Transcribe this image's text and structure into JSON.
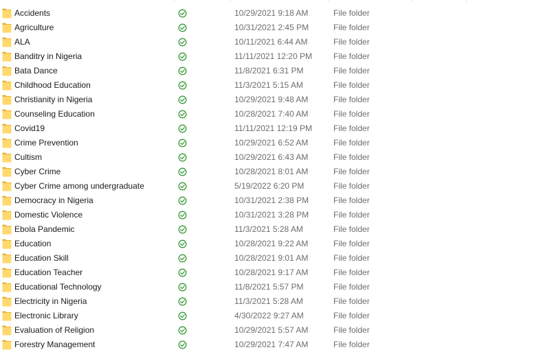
{
  "colors": {
    "folder_fill": "#FFD86E",
    "folder_edge": "#E8B43A",
    "sync_ok": "#3A9A3A",
    "name_text": "#1a1a1a",
    "meta_text": "#6d6d6d"
  },
  "icons": {
    "folder": "folder-icon",
    "status": "sync-available-icon"
  },
  "files": [
    {
      "name": "Accidents",
      "modified": "10/29/2021 9:18 AM",
      "type": "File folder"
    },
    {
      "name": "Agriculture",
      "modified": "10/31/2021 2:45 PM",
      "type": "File folder"
    },
    {
      "name": "ALA",
      "modified": "10/11/2021 6:44 AM",
      "type": "File folder"
    },
    {
      "name": "Banditry in Nigeria",
      "modified": "11/11/2021 12:20 PM",
      "type": "File folder"
    },
    {
      "name": "Bata Dance",
      "modified": "11/8/2021 6:31 PM",
      "type": "File folder"
    },
    {
      "name": "Childhood Education",
      "modified": "11/3/2021 5:15 AM",
      "type": "File folder"
    },
    {
      "name": "Christianity in Nigeria",
      "modified": "10/29/2021 9:48 AM",
      "type": "File folder"
    },
    {
      "name": "Counseling Education",
      "modified": "10/28/2021 7:40 AM",
      "type": "File folder"
    },
    {
      "name": "Covid19",
      "modified": "11/11/2021 12:19 PM",
      "type": "File folder"
    },
    {
      "name": "Crime Prevention",
      "modified": "10/29/2021 6:52 AM",
      "type": "File folder"
    },
    {
      "name": "Cultism",
      "modified": "10/29/2021 6:43 AM",
      "type": "File folder"
    },
    {
      "name": "Cyber Crime",
      "modified": "10/28/2021 8:01 AM",
      "type": "File folder"
    },
    {
      "name": "Cyber Crime among undergraduate",
      "modified": "5/19/2022 6:20 PM",
      "type": "File folder"
    },
    {
      "name": "Democracy in Nigeria",
      "modified": "10/31/2021 2:38 PM",
      "type": "File folder"
    },
    {
      "name": "Domestic Violence",
      "modified": "10/31/2021 3:28 PM",
      "type": "File folder"
    },
    {
      "name": "Ebola Pandemic",
      "modified": "11/3/2021 5:28 AM",
      "type": "File folder"
    },
    {
      "name": "Education",
      "modified": "10/28/2021 9:22 AM",
      "type": "File folder"
    },
    {
      "name": "Education Skill",
      "modified": "10/28/2021 9:01 AM",
      "type": "File folder"
    },
    {
      "name": "Education Teacher",
      "modified": "10/28/2021 9:17 AM",
      "type": "File folder"
    },
    {
      "name": "Educational Technology",
      "modified": "11/8/2021 5:57 PM",
      "type": "File folder"
    },
    {
      "name": "Electricity in Nigeria",
      "modified": "11/3/2021 5:28 AM",
      "type": "File folder"
    },
    {
      "name": "Electronic Library",
      "modified": "4/30/2022 9:27 AM",
      "type": "File folder"
    },
    {
      "name": "Evaluation of Religion",
      "modified": "10/29/2021 5:57 AM",
      "type": "File folder"
    },
    {
      "name": "Forestry Management",
      "modified": "10/29/2021 7:47 AM",
      "type": "File folder"
    }
  ]
}
